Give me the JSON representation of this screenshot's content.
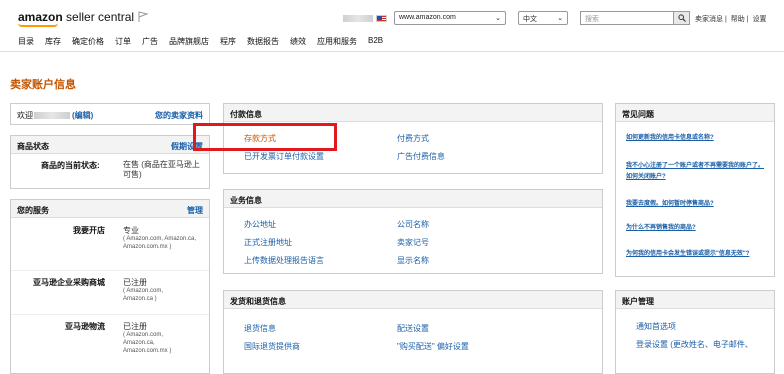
{
  "header": {
    "logo_brand": "amazon",
    "logo_text": "seller central",
    "marketplace_select": "www.amazon.com",
    "language_select": "中文",
    "search_placeholder": "搜索",
    "top_links": [
      "卖家消息",
      "帮助",
      "设置"
    ],
    "separator": "|"
  },
  "nav": [
    "目录",
    "库存",
    "确定价格",
    "订单",
    "广告",
    "品牌旗舰店",
    "程序",
    "数据报告",
    "绩效",
    "应用和服务",
    "B2B"
  ],
  "page_title": "卖家账户信息",
  "welcome_box": {
    "welcome_prefix": "欢迎",
    "edit_link": "(编辑)",
    "seller_profile_link": "您的卖家资料"
  },
  "listing_status": {
    "title": "商品状态",
    "action": "假期设置",
    "label": "商品的当前状态:",
    "value": "在售 (商品在亚马逊上可售)"
  },
  "services": {
    "title": "您的服务",
    "action": "管理",
    "items": [
      {
        "name": "我要开店",
        "status": "专业",
        "detail": "( Amazon.com, Amazon.ca, Amazon.com.mx )"
      },
      {
        "name": "亚马逊企业采购商城",
        "status": "已注册",
        "detail": "( Amazon.com, Amazon.ca )"
      },
      {
        "name": "亚马逊物流",
        "status": "已注册",
        "detail": "( Amazon.com, Amazon.ca, Amazon.com.mx )"
      }
    ]
  },
  "payment_info": {
    "title": "付款信息",
    "left": [
      "存款方式",
      "已开发票订单付款设置"
    ],
    "right": [
      "付费方式",
      "广告付费信息"
    ]
  },
  "business_info": {
    "title": "业务信息",
    "left": [
      "办公地址",
      "正式注册地址",
      "上传数据处理报告语言"
    ],
    "right": [
      "公司名称",
      "卖家记号",
      "显示名称"
    ]
  },
  "shipping_returns": {
    "title": "发货和退货信息",
    "left": [
      "退货信息",
      "国际退货提供商"
    ],
    "right": [
      "配送设置",
      "\"购买配送\" 偏好设置"
    ]
  },
  "faq": {
    "title": "常见问题",
    "items": [
      "如何更新我的信用卡信息或名称?",
      "我不小心注册了一个账户或者不再需要我的账户了。如何关闭账户?",
      "我要去度假。如何暂时停售商品?",
      "为什么不再销售我的商品?",
      "为何我的信用卡会发生错误或提示\"信息无效\"?"
    ]
  },
  "account_mgmt": {
    "title": "账户管理",
    "items": [
      "通知首选项",
      "登录设置 (更改姓名、电子邮件、"
    ]
  },
  "colors": {
    "accent": "#c45500",
    "link": "#1a5fa8",
    "highlight": "#e0191f"
  },
  "icons": [
    "flag-icon",
    "us-flag-icon",
    "chevron-down-icon",
    "search-icon"
  ]
}
